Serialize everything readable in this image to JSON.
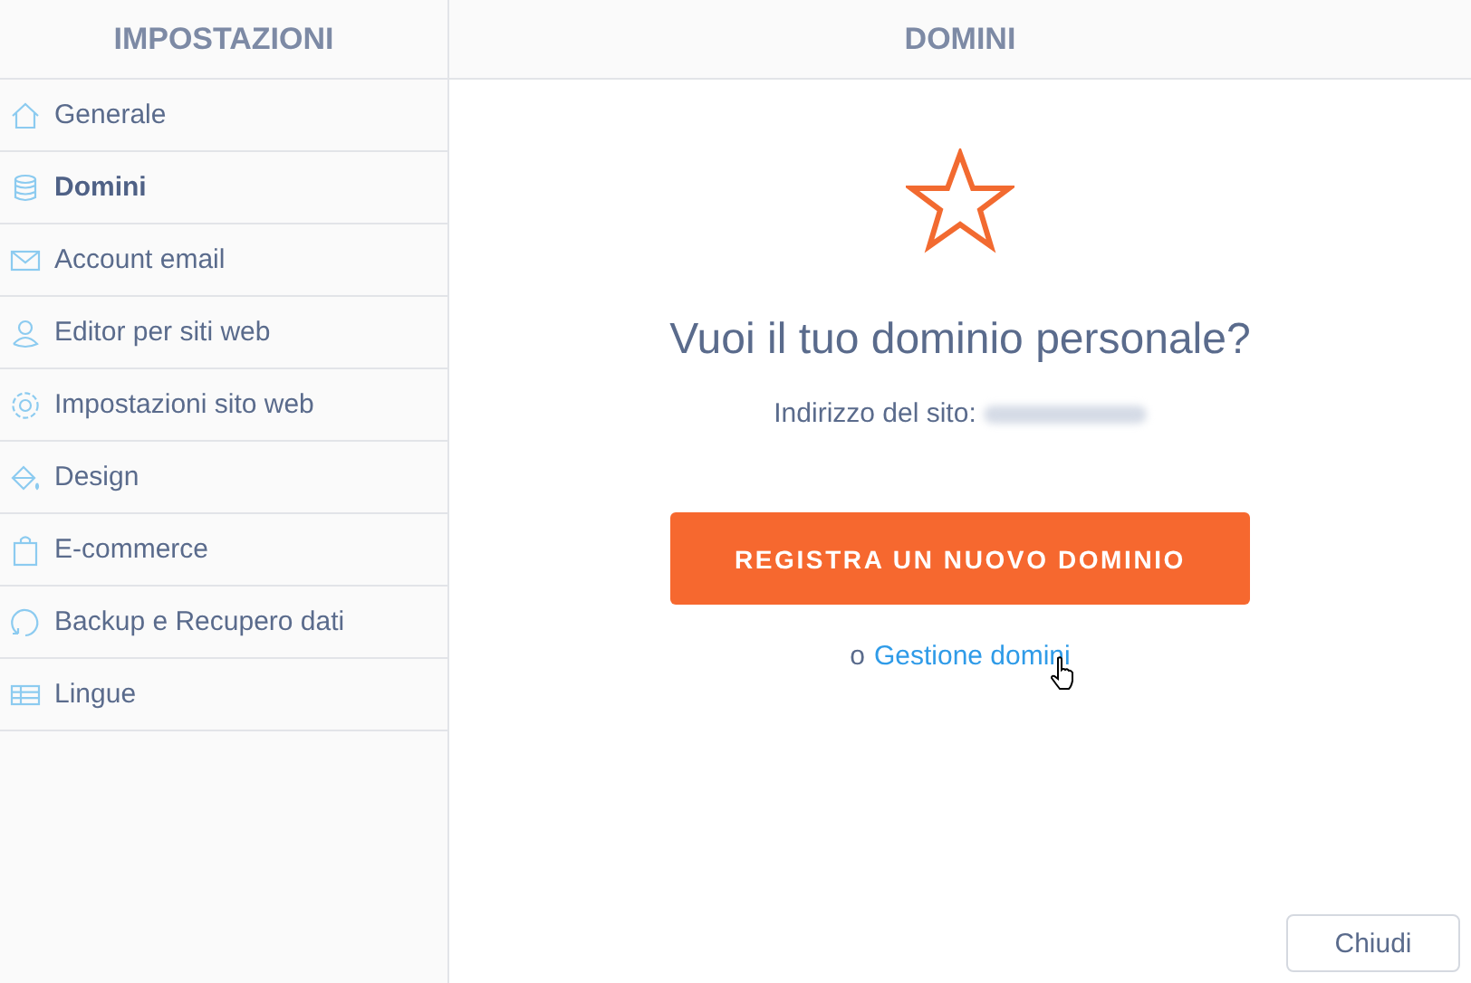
{
  "sidebar": {
    "title": "IMPOSTAZIONI",
    "items": [
      {
        "label": "Generale",
        "kind": "home",
        "selected": false
      },
      {
        "label": "Domini",
        "kind": "database",
        "selected": true
      },
      {
        "label": "Account email",
        "kind": "mail",
        "selected": false
      },
      {
        "label": "Editor per siti web",
        "kind": "user",
        "selected": false
      },
      {
        "label": "Impostazioni sito web",
        "kind": "gear",
        "selected": false
      },
      {
        "label": "Design",
        "kind": "paint",
        "selected": false
      },
      {
        "label": "E-commerce",
        "kind": "bag",
        "selected": false
      },
      {
        "label": "Backup e Recupero dati",
        "kind": "restore",
        "selected": false
      },
      {
        "label": "Lingue",
        "kind": "table",
        "selected": false
      }
    ]
  },
  "main": {
    "title": "DOMINI",
    "heading": "Vuoi il tuo dominio personale?",
    "address_label": "Indirizzo del sito:",
    "primary_button": "REGISTRA UN NUOVO DOMINIO",
    "alt_prefix": "o",
    "alt_link": "Gestione domini"
  },
  "close_button": "Chiudi"
}
